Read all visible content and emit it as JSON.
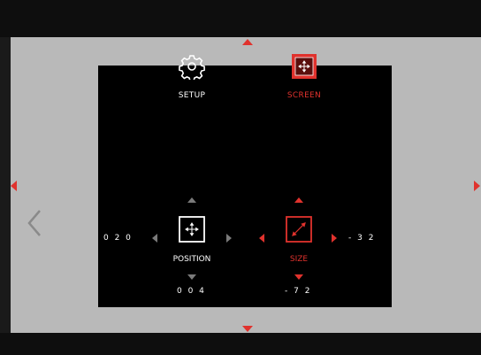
{
  "menu": {
    "setup_label": "SETUP",
    "screen_label": "SCREEN",
    "active_tab": "SCREEN"
  },
  "position": {
    "label": "POSITION",
    "horizontal_value": "0 2 0",
    "vertical_value": "0 0 4"
  },
  "size": {
    "label": "SIZE",
    "horizontal_value": "- 3 2",
    "vertical_value": "- 7 2"
  },
  "colors": {
    "accent": "#e0322d",
    "panel": "#000000",
    "screen_background": "#b9b9b9",
    "inactive_arrow": "#7a7a7a"
  },
  "icons": {
    "setup": "gear-icon",
    "screen": "screen-move-icon",
    "position": "move-cross-icon",
    "size": "resize-diagonal-icon",
    "back": "chevron-left-icon"
  }
}
